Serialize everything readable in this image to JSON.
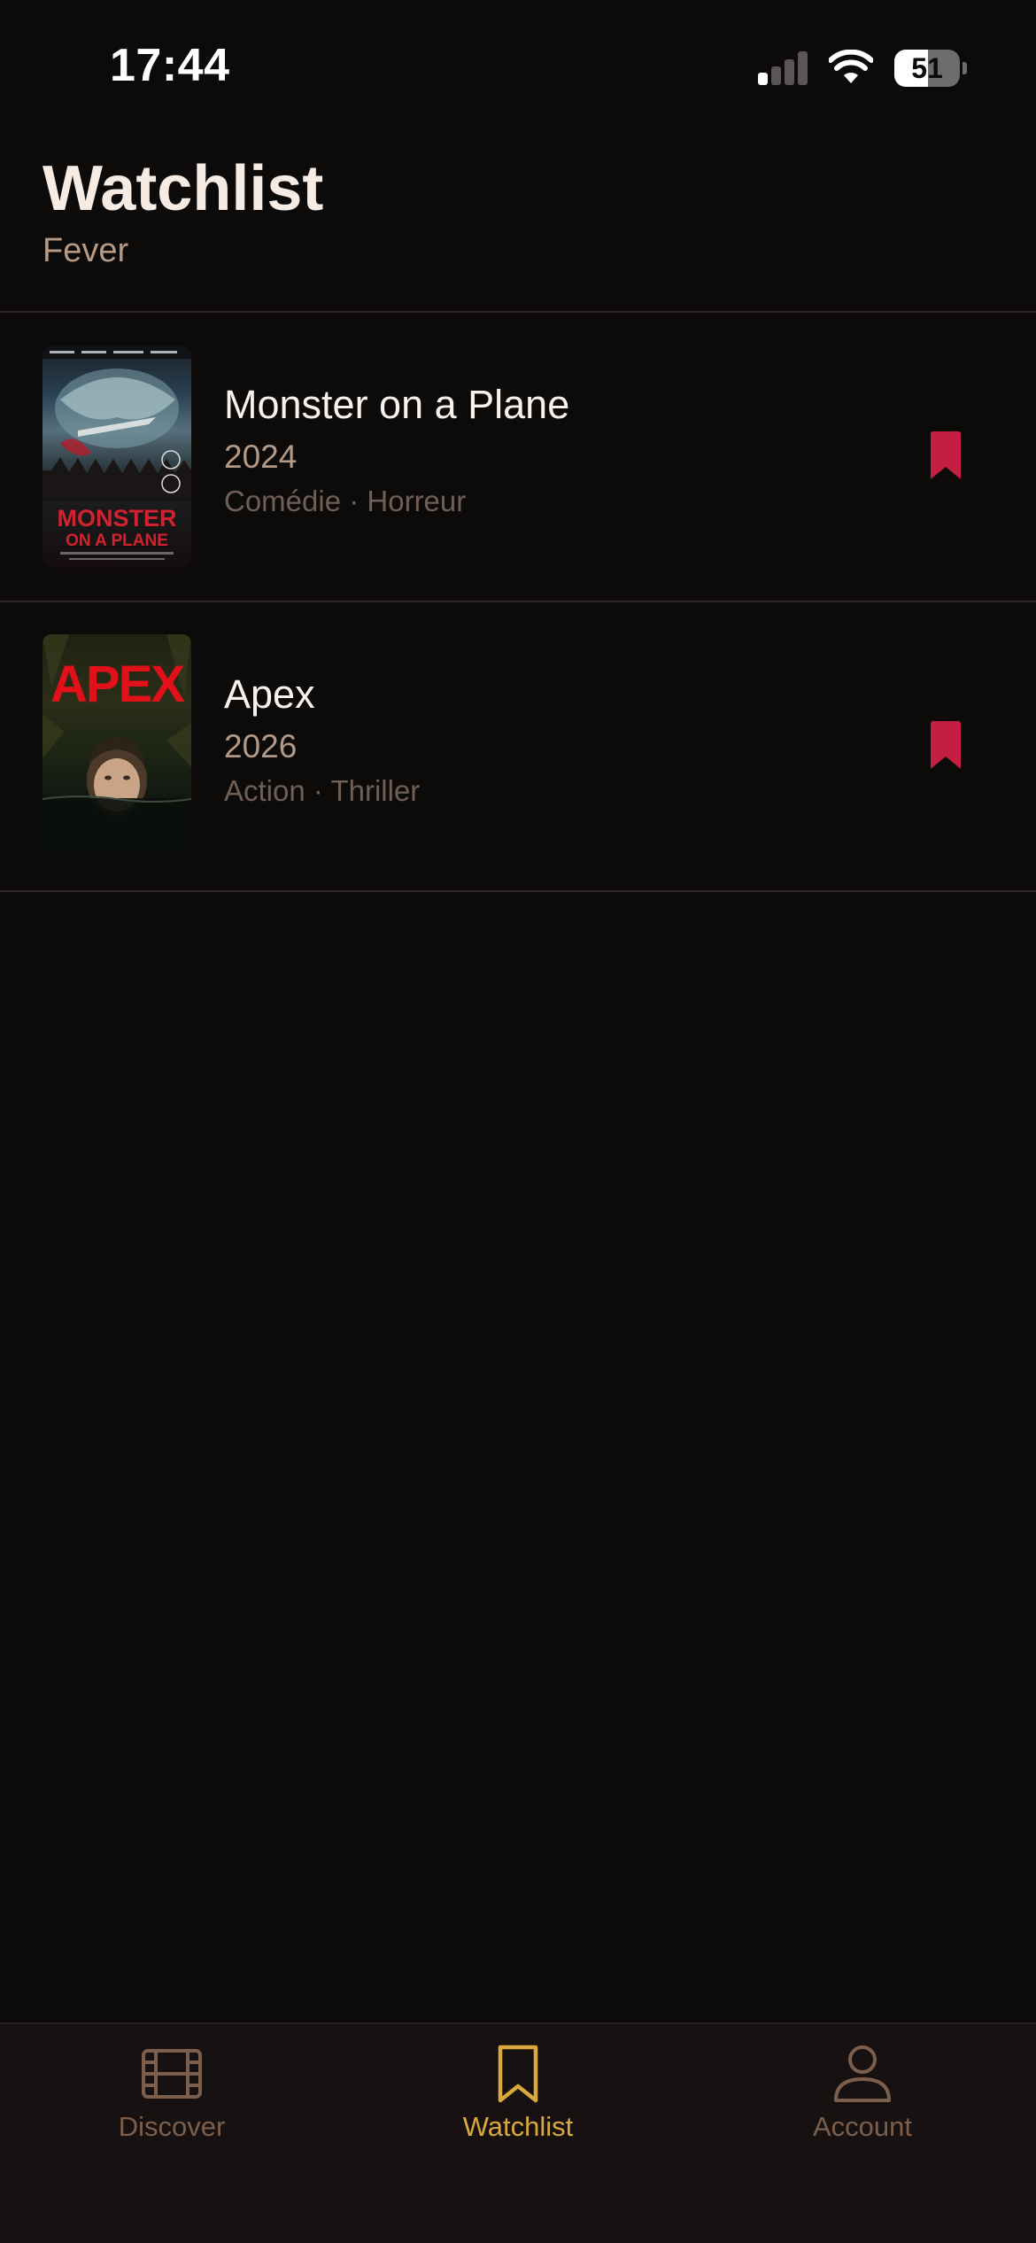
{
  "status_bar": {
    "time": "17:44",
    "battery": "51",
    "battery_level": 0.51
  },
  "header": {
    "title": "Watchlist",
    "subtitle": "Fever"
  },
  "items": [
    {
      "title": "Monster on a Plane",
      "year": "2024",
      "genres": "Comédie · Horreur",
      "poster_text_line1": "MONSTER",
      "poster_text_line2": "ON A PLANE",
      "bookmarked": true
    },
    {
      "title": "Apex",
      "year": "2026",
      "genres": "Action · Thriller",
      "poster_text_line1": "APEX",
      "bookmarked": true
    }
  ],
  "tabs": [
    {
      "label": "Discover",
      "icon": "film-icon",
      "active": false
    },
    {
      "label": "Watchlist",
      "icon": "bookmark-icon",
      "active": true
    },
    {
      "label": "Account",
      "icon": "person-icon",
      "active": false
    }
  ],
  "colors": {
    "background": "#0d0a0a",
    "accent_active": "#d9a93e",
    "tab_inactive": "#7b5f4c",
    "bookmark": "#c41f43",
    "title": "#f6ece4"
  }
}
